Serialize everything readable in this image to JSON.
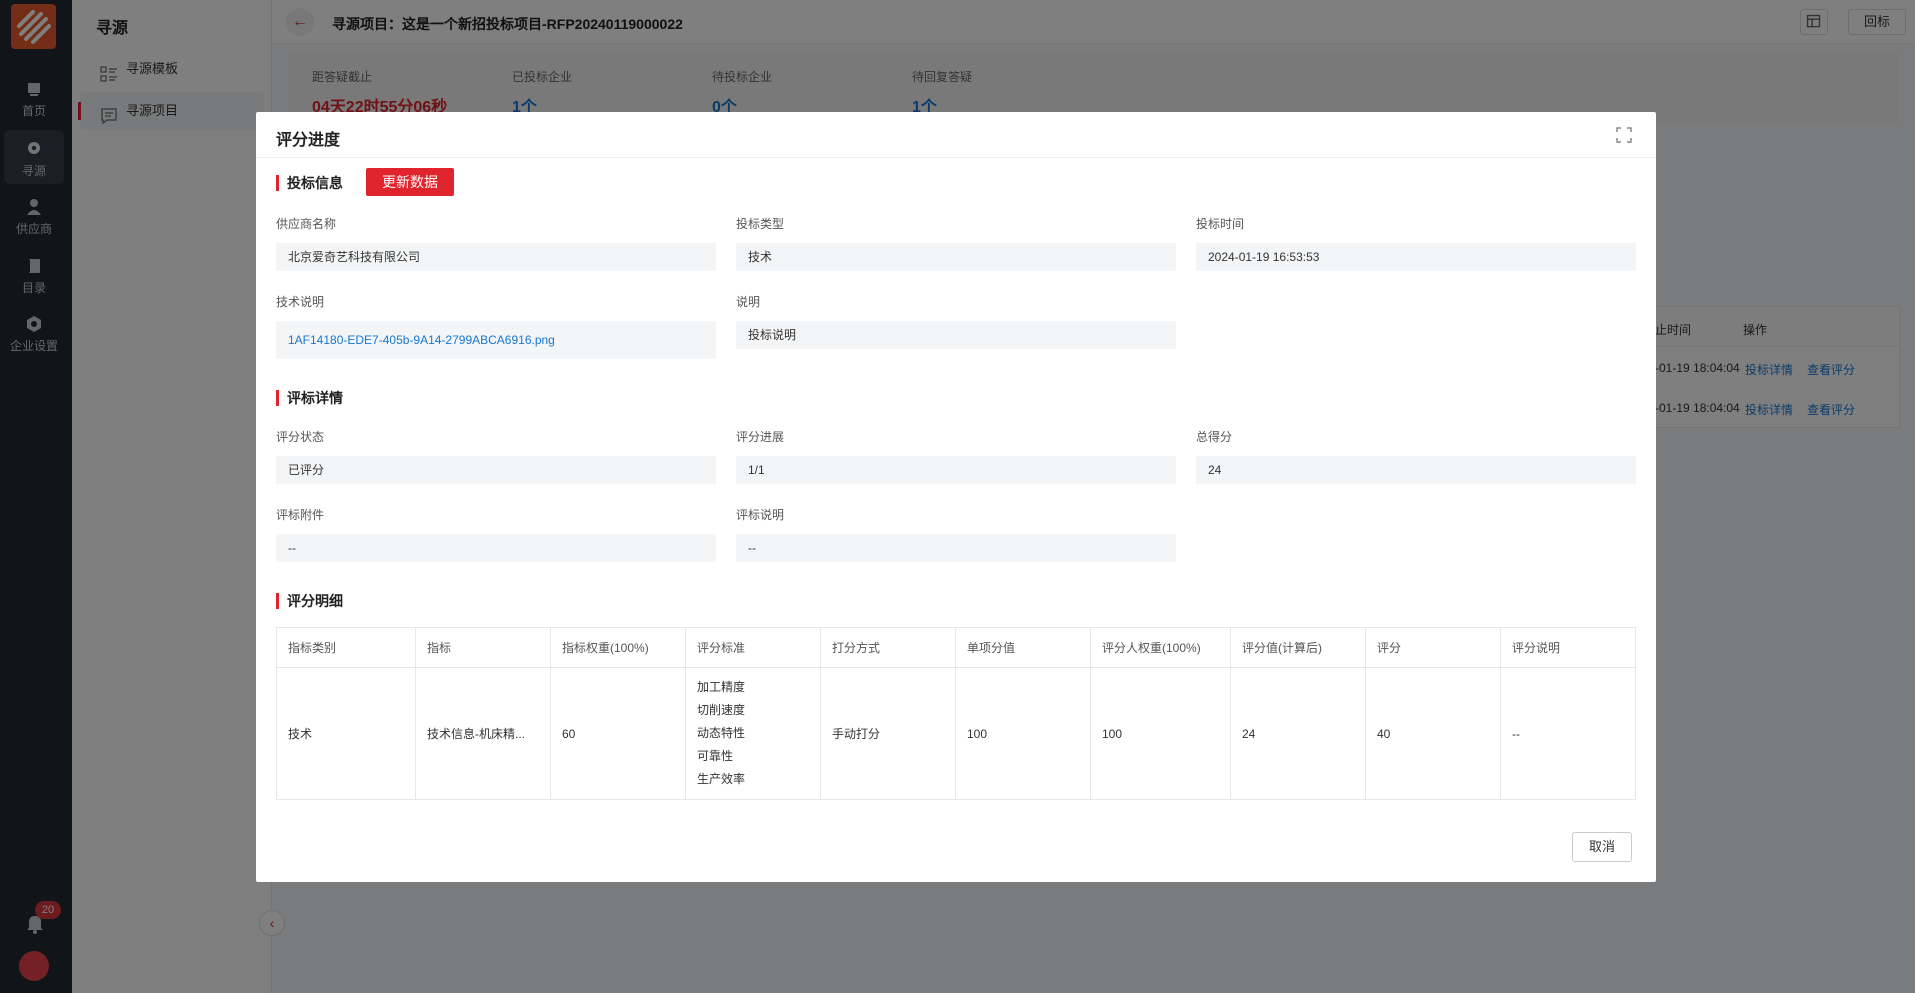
{
  "rail": {
    "items": [
      {
        "label": "首页",
        "icon": "home-icon"
      },
      {
        "label": "寻源",
        "icon": "search-source-icon"
      },
      {
        "label": "供应商",
        "icon": "user-icon"
      },
      {
        "label": "目录",
        "icon": "book-icon"
      },
      {
        "label": "企业设置",
        "icon": "gear-icon"
      }
    ],
    "notification_count": "20"
  },
  "subnav": {
    "title": "寻源",
    "items": [
      {
        "label": "寻源模板"
      },
      {
        "label": "寻源项目"
      }
    ]
  },
  "topbar": {
    "title": "寻源项目：这是一个新招投标项目-RFP20240119000022",
    "reply_label": "回标"
  },
  "stats": [
    {
      "label": "距答疑截止",
      "value": "04天22时55分06秒"
    },
    {
      "label": "已投标企业",
      "value": "1个"
    },
    {
      "label": "待投标企业",
      "value": "0个"
    },
    {
      "label": "待回复答疑",
      "value": "1个"
    }
  ],
  "bg_table": {
    "headers": [
      "止时间",
      "操作"
    ],
    "rows": [
      {
        "time": "-01-19 18:04:04",
        "detail": "投标详情",
        "view": "查看评分"
      },
      {
        "time": "-01-19 18:04:04",
        "detail": "投标详情",
        "view": "查看评分"
      }
    ]
  },
  "modal": {
    "title": "评分进度",
    "bid_info": {
      "section_title": "投标信息",
      "refresh_label": "更新数据",
      "supplier_name_label": "供应商名称",
      "supplier_name": "北京爱奇艺科技有限公司",
      "bid_type_label": "投标类型",
      "bid_type": "技术",
      "bid_time_label": "投标时间",
      "bid_time": "2024-01-19 16:53:53",
      "tech_desc_label": "技术说明",
      "tech_desc_file": "1AF14180-EDE7-405b-9A14-2799ABCA6916.png",
      "remark_label": "说明",
      "remark": "投标说明"
    },
    "eval_detail": {
      "section_title": "评标详情",
      "status_label": "评分状态",
      "status": "已评分",
      "progress_label": "评分进展",
      "progress": "1/1",
      "total_label": "总得分",
      "total": "24",
      "attachment_label": "评标附件",
      "attachment": "--",
      "desc_label": "评标说明",
      "desc": "--"
    },
    "score_detail": {
      "section_title": "评分明细",
      "columns": [
        "指标类别",
        "指标",
        "指标权重(100%)",
        "评分标准",
        "打分方式",
        "单项分值",
        "评分人权重(100%)",
        "评分值(计算后)",
        "评分",
        "评分说明"
      ],
      "rows": [
        {
          "category": "技术",
          "indicator": "技术信息-机床精...",
          "weight": "60",
          "criteria": [
            "加工精度",
            "切削速度",
            "动态特性",
            "可靠性",
            "生产效率"
          ],
          "method": "手动打分",
          "item_score": "100",
          "rater_weight": "100",
          "calc_score": "24",
          "score": "40",
          "remark": "--"
        }
      ]
    },
    "cancel_label": "取消"
  }
}
